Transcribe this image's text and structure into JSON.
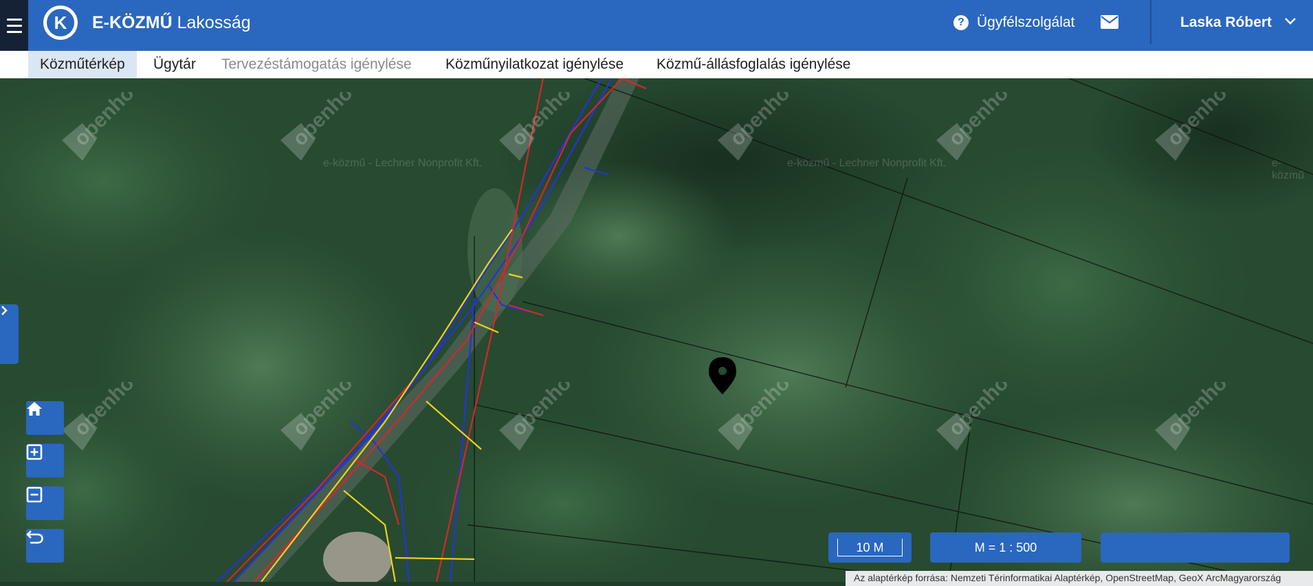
{
  "header": {
    "brand_bold": "E-KÖZMŰ",
    "brand_light": "Lakosság",
    "logo_letter": "K",
    "help_label": "Ügyfélszolgálat",
    "user_name": "Laska Róbert",
    "icons": [
      "menu-icon",
      "help-icon",
      "mail-icon",
      "chevron-down-icon"
    ],
    "colors": {
      "primary": "#2a67bf",
      "menu_bg": "#152236",
      "active_tab_bg": "#dbe6f3"
    }
  },
  "nav": {
    "tabs": [
      {
        "label": "Közműtérkép",
        "state": "active"
      },
      {
        "label": "Ügytár",
        "state": "normal"
      },
      {
        "label": "Tervezéstámogatás igénylése",
        "state": "disabled"
      },
      {
        "label": "Közműnyilatkozat igénylése",
        "state": "normal"
      },
      {
        "label": "Közmű-állásfoglalás igénylése",
        "state": "normal"
      }
    ]
  },
  "map": {
    "watermark_text": "openhouse",
    "credit_text_1": "e-közmű - Lechner Nonprofit Kft.",
    "credit_text_2": "e-közmű - Lechner Nonprofit Kft.",
    "credit_text_3": "e-közmű",
    "controls": [
      "home-icon",
      "zoom-in-icon",
      "zoom-out-icon",
      "undo-icon"
    ],
    "scale_bar": "10 M",
    "scale_ratio": "M = 1 : 500",
    "coordinates": "",
    "attribution": "Az alaptérkép forrása: Nemzeti Térinformatikai Alaptérkép, OpenStreetMap, GeoX ArcMagyarország",
    "utility_colors": {
      "electric": "#d6262b",
      "gas": "#f0d21a",
      "water": "#2434d8",
      "parcel": "#0c120d"
    }
  }
}
